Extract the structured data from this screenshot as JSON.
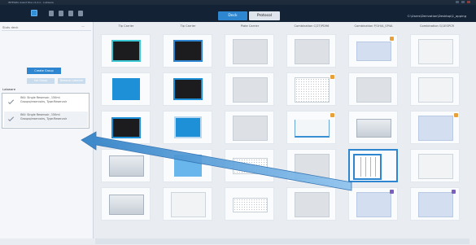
{
  "window": {
    "title": "INTEGRA Assist Plus v1.0.x - Labware"
  },
  "toolbar": {
    "tabs": [
      {
        "label": "Deck"
      },
      {
        "label": "Protocol"
      }
    ],
    "path": "C:\\Users\\Derivation\\Desktop\\1_apping"
  },
  "left_panel": {
    "header": "Slots deck",
    "create_button": "Create Group",
    "sub_buttons": [
      "Set Group",
      "Remove Labware"
    ],
    "labware_header": "Labware",
    "labware_items": [
      {
        "text": "INU: Single Reservoir, 150ml Groups/reservoirs, Type:Reservoir"
      },
      {
        "text": "INU: Single Reservoir, 150ml Groups/reservoirs, Type:Reservoir"
      }
    ]
  },
  "grid": {
    "columns": [
      "Tip Carrier",
      "Tip Carrier",
      "Plate Carrier",
      "Combination C/2T/PD96",
      "Combination P/1H/A_SP4A",
      "Combination G/1ESPCR"
    ]
  },
  "colors": {
    "accent": "#2d86cf",
    "toolbar_bg": "#142235",
    "tip_outline": "#3cc7d4",
    "badge_orange": "#e8a13a",
    "badge_purple": "#7a5ec0"
  }
}
